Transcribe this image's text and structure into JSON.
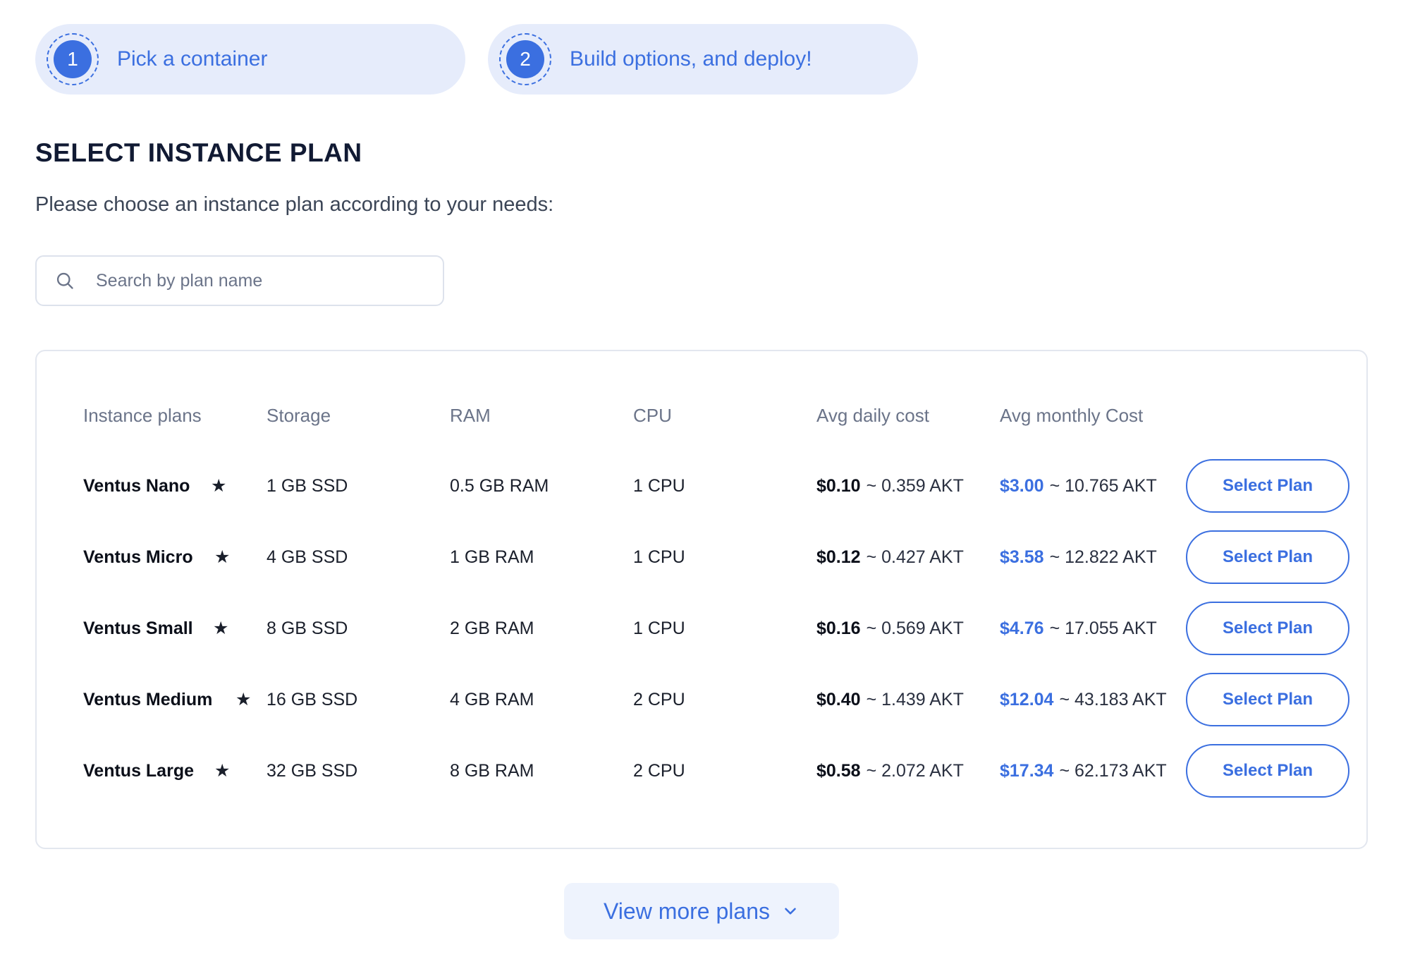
{
  "steps": [
    {
      "number": "1",
      "label": "Pick a container"
    },
    {
      "number": "2",
      "label": "Build options, and deploy!"
    }
  ],
  "title": "SELECT INSTANCE PLAN",
  "subtitle": "Please choose an instance plan according to your needs:",
  "search": {
    "placeholder": "Search by plan name",
    "value": "",
    "icon": "search-icon"
  },
  "table": {
    "headers": [
      "Instance plans",
      "Storage",
      "RAM",
      "CPU",
      "Avg daily cost",
      "Avg monthly Cost"
    ],
    "rows": [
      {
        "name": "Ventus Nano",
        "star": "★",
        "storage": "1 GB SSD",
        "ram": "0.5 GB RAM",
        "cpu": "1 CPU",
        "daily_usd": "$0.10",
        "daily_akt": "~ 0.359 AKT",
        "monthly_usd": "$3.00",
        "monthly_akt": "~ 10.765 AKT",
        "action": "Select Plan"
      },
      {
        "name": "Ventus Micro",
        "star": "★",
        "storage": "4 GB SSD",
        "ram": "1 GB RAM",
        "cpu": "1 CPU",
        "daily_usd": "$0.12",
        "daily_akt": "~ 0.427 AKT",
        "monthly_usd": "$3.58",
        "monthly_akt": "~ 12.822 AKT",
        "action": "Select Plan"
      },
      {
        "name": "Ventus Small",
        "star": "★",
        "storage": "8 GB SSD",
        "ram": "2 GB RAM",
        "cpu": "1 CPU",
        "daily_usd": "$0.16",
        "daily_akt": "~ 0.569 AKT",
        "monthly_usd": "$4.76",
        "monthly_akt": "~ 17.055 AKT",
        "action": "Select Plan"
      },
      {
        "name": "Ventus Medium",
        "star": "★",
        "storage": "16 GB SSD",
        "ram": "4 GB RAM",
        "cpu": "2 CPU",
        "daily_usd": "$0.40",
        "daily_akt": "~ 1.439 AKT",
        "monthly_usd": "$12.04",
        "monthly_akt": "~ 43.183 AKT",
        "action": "Select Plan"
      },
      {
        "name": "Ventus Large",
        "star": "★",
        "storage": "32 GB SSD",
        "ram": "8 GB RAM",
        "cpu": "2 CPU",
        "daily_usd": "$0.58",
        "daily_akt": "~ 2.072 AKT",
        "monthly_usd": "$17.34",
        "monthly_akt": "~ 62.173 AKT",
        "action": "Select Plan"
      }
    ]
  },
  "view_more": {
    "label": "View more plans",
    "icon": "chevron-down-icon"
  },
  "colors": {
    "accent": "#3b6fe0",
    "step_bg": "#e6ecfb",
    "star": "#4a7fd8"
  }
}
